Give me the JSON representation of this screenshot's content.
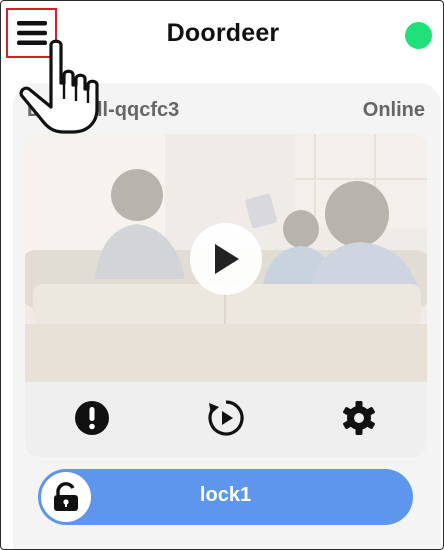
{
  "app": {
    "title": "Doordeer",
    "connection_color": "#1fe079"
  },
  "header": {
    "menu_icon": "hamburger-menu-icon",
    "highlight_color": "#d81e2a"
  },
  "device": {
    "name": "Doorbell-qqcfc3",
    "status": "Online"
  },
  "video": {
    "play_icon": "play-icon"
  },
  "controls": [
    {
      "name": "alert-icon"
    },
    {
      "name": "playback-icon"
    },
    {
      "name": "settings-gear-icon"
    }
  ],
  "lock": {
    "label": "lock1",
    "icon": "unlocked-padlock-icon",
    "color": "#5e96ee"
  },
  "cursor": {
    "icon": "hand-pointer-icon"
  }
}
